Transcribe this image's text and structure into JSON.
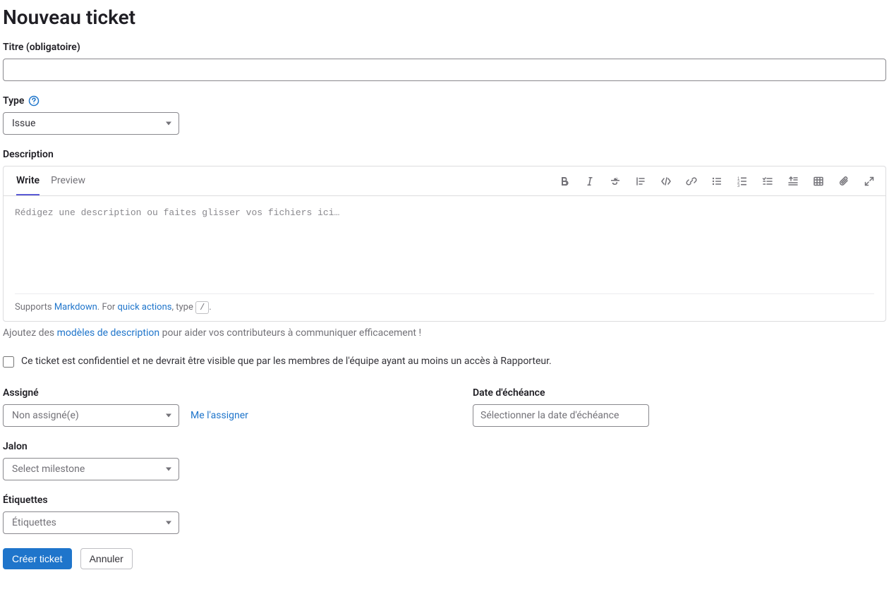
{
  "page_title": "Nouveau ticket",
  "title_field": {
    "label": "Titre (obligatoire)",
    "value": ""
  },
  "type_field": {
    "label": "Type",
    "selected": "Issue"
  },
  "description": {
    "label": "Description",
    "tabs": {
      "write": "Write",
      "preview": "Preview"
    },
    "placeholder": "Rédigez une description ou faites glisser vos fichiers ici…",
    "footer_pre": "Supports ",
    "footer_markdown": "Markdown",
    "footer_mid": ". For ",
    "footer_quick": "quick actions",
    "footer_type": ", type ",
    "footer_kbd": "/",
    "footer_dot": ".",
    "help_pre": "Ajoutez des ",
    "help_link": "modèles de description",
    "help_post": " pour aider vos contributeurs à communiquer efficacement !"
  },
  "confidential": {
    "label": "Ce ticket est confidentiel et ne devrait être visible que par les membres de l'équipe ayant au moins un accès à Rapporteur."
  },
  "assignee": {
    "label": "Assigné",
    "placeholder": "Non assigné(e)",
    "self_link": "Me l'assigner"
  },
  "due_date": {
    "label": "Date d'échéance",
    "placeholder": "Sélectionner la date d'échéance"
  },
  "milestone": {
    "label": "Jalon",
    "placeholder": "Select milestone"
  },
  "labels_field": {
    "label": "Étiquettes",
    "placeholder": "Étiquettes"
  },
  "buttons": {
    "submit": "Créer ticket",
    "cancel": "Annuler"
  }
}
